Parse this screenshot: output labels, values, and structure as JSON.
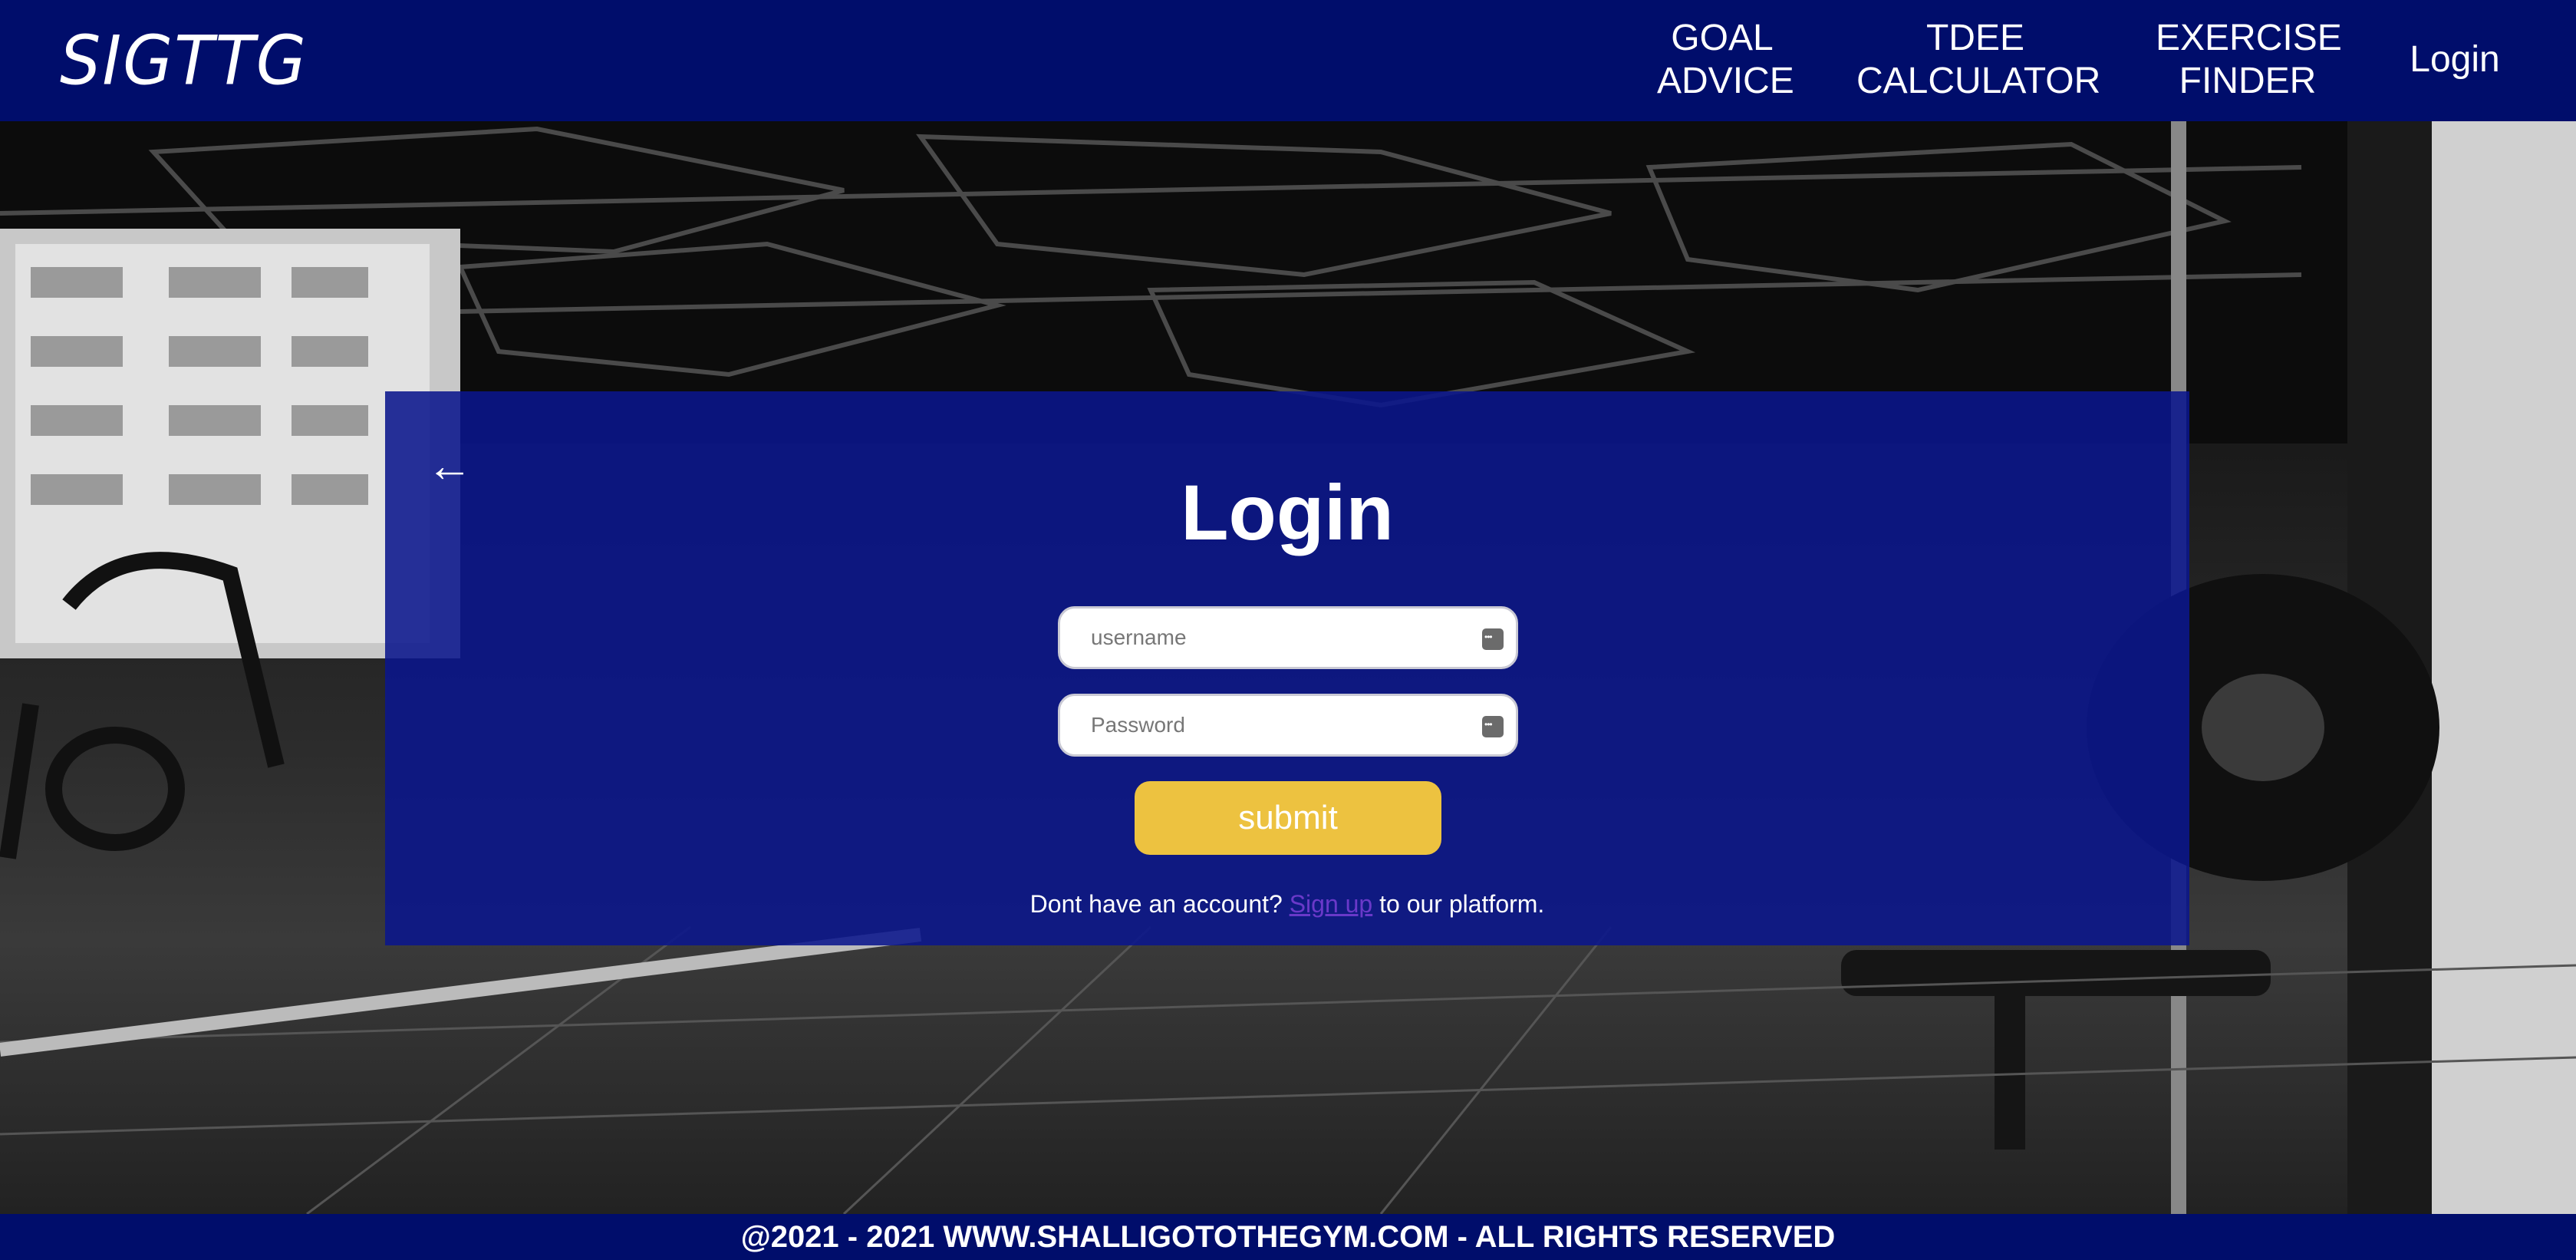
{
  "nav": {
    "logo": "SIGTTG",
    "items": [
      {
        "label_line1": "GOAL",
        "label_line2": "ADVICE"
      },
      {
        "label_line1": "TDEE",
        "label_line2": "CALCULATOR"
      },
      {
        "label_line1": "EXERCISE",
        "label_line2": "FINDER"
      },
      {
        "label_line1": "Login",
        "label_line2": ""
      }
    ]
  },
  "login": {
    "back_icon": "←",
    "title": "Login",
    "username_placeholder": "username",
    "password_placeholder": "Password",
    "submit_label": "submit",
    "signup_prefix": "Dont have an account?",
    "signup_link": "Sign up",
    "signup_suffix": "to our platform."
  },
  "footer": {
    "text": "@2021 - 2021 WWW.SHALLIGOTOTHEGYM.COM - ALL RIGHTS RESERVED"
  },
  "colors": {
    "navbar": "#000d6b",
    "panel": "#0a168c",
    "submit": "#edc240",
    "link": "#6a39c9"
  }
}
